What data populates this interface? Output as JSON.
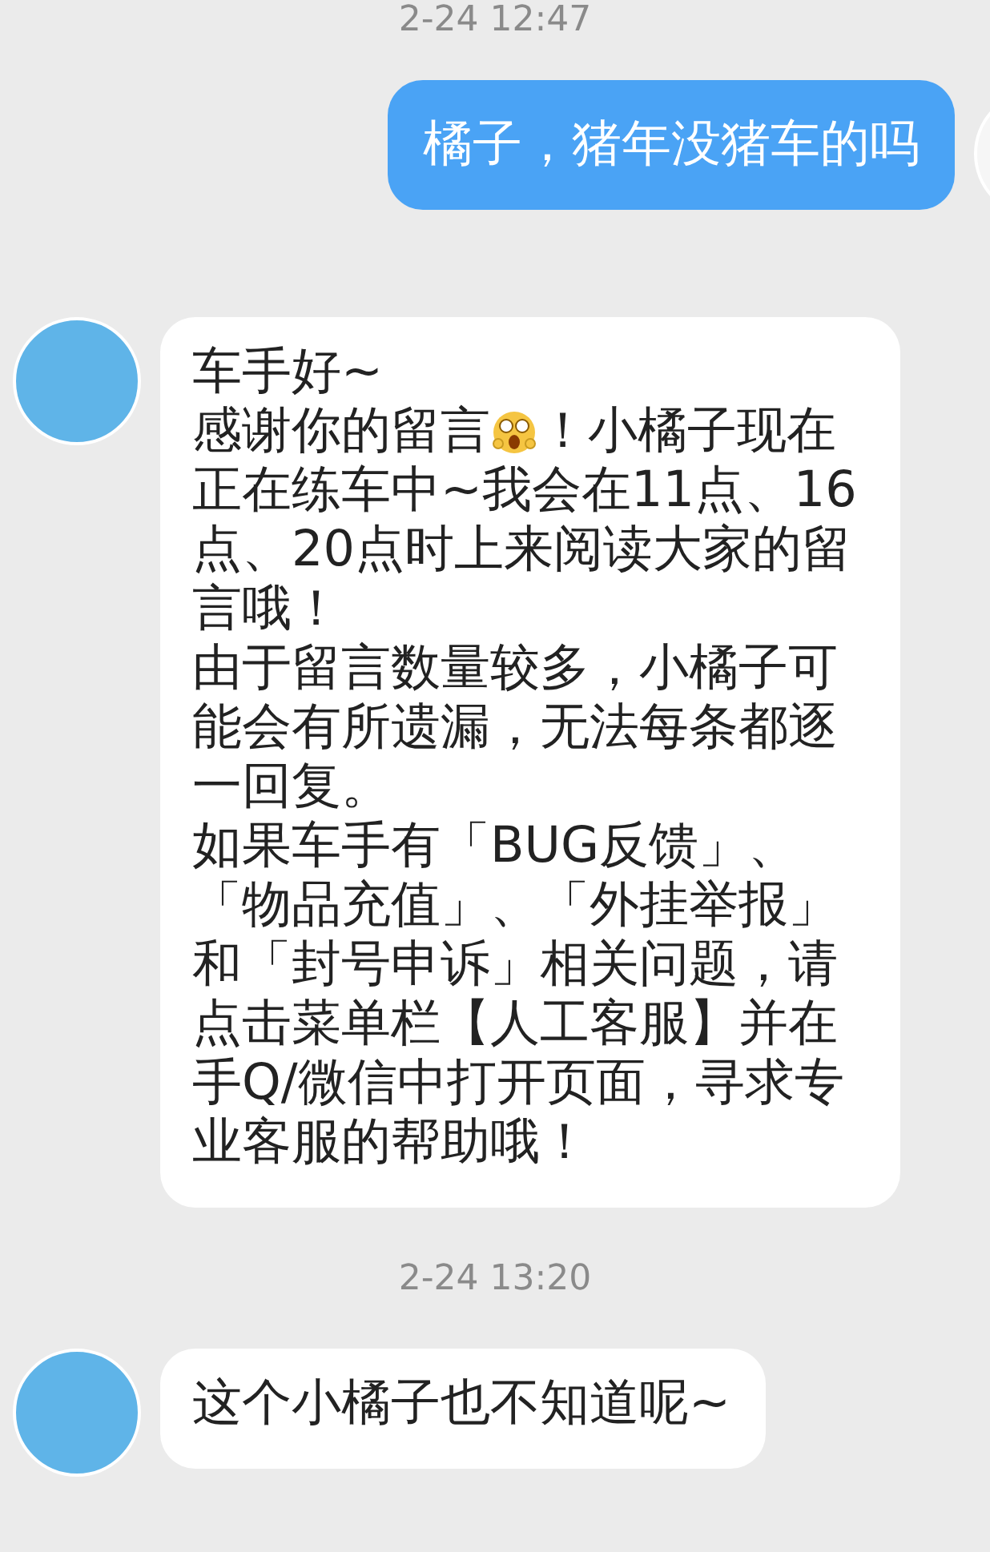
{
  "chat": [
    {
      "kind": "timestamp",
      "text": "2-24 12:47"
    },
    {
      "kind": "outgoing",
      "paragraphs": [
        [
          {
            "kind": "text",
            "text": "橘子，猪年没猪车的吗"
          }
        ]
      ]
    },
    {
      "kind": "incoming",
      "paragraphs": [
        [
          {
            "kind": "text",
            "text": "车手好~"
          }
        ],
        [
          {
            "kind": "text",
            "text": "感谢你的留言"
          },
          {
            "kind": "emoji"
          },
          {
            "kind": "text",
            "text": "！小橘子现在"
          }
        ],
        [
          {
            "kind": "text",
            "text": "正在练车中~我会在11点、16点、20点时上来阅读大家的留言哦！"
          }
        ],
        [
          {
            "kind": "text",
            "text": "由于留言数量较多，小橘子可能会有所遗漏，无法每条都逐一回复。"
          }
        ],
        [
          {
            "kind": "text",
            "text": "如果车手有「BUG反馈」、「物品充值」、「外挂举报」和「封号申诉」相关问题，请点击菜单栏【人工客服】并在手Q/微信中打开页面，寻求专业客服的帮助哦！"
          }
        ]
      ]
    },
    {
      "kind": "timestamp",
      "text": "2-24 13:20"
    },
    {
      "kind": "incoming",
      "paragraphs": [
        [
          {
            "kind": "text",
            "text": "这个小橘子也不知道呢~"
          }
        ]
      ]
    }
  ]
}
